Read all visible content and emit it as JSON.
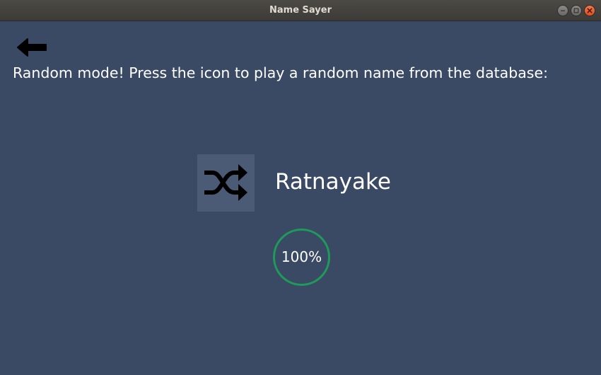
{
  "window": {
    "title": "Name Sayer"
  },
  "instruction": "Random mode! Press the icon to play a random name from the database:",
  "current_name": "Ratnayake",
  "progress": {
    "label": "100%",
    "value": 100
  },
  "icons": {
    "back": "arrow-left-icon",
    "shuffle": "shuffle-icon"
  },
  "colors": {
    "background": "#3a4a65",
    "button_background": "#4b5a75",
    "progress_ring": "#1e9a5a",
    "text": "#ffffff"
  }
}
